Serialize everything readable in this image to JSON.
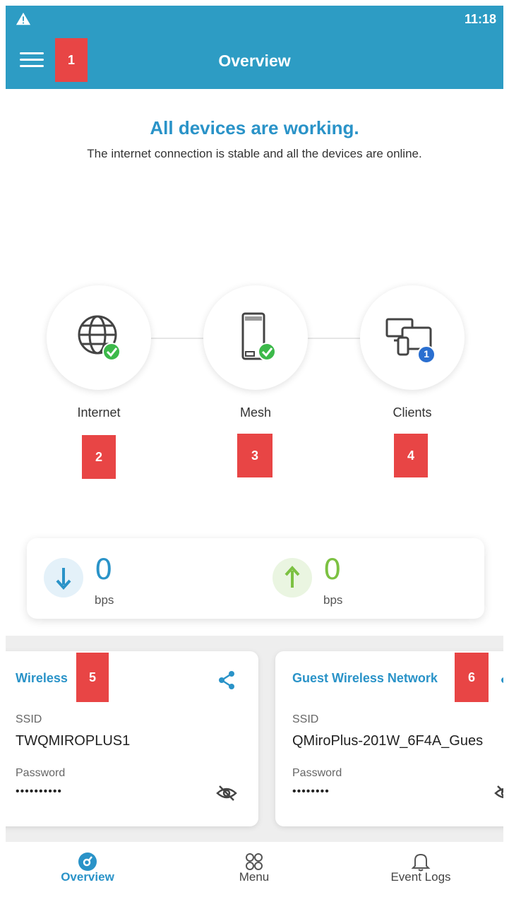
{
  "status_bar": {
    "time": "11:18"
  },
  "app_bar": {
    "title": "Overview"
  },
  "annotations": [
    "1",
    "2",
    "3",
    "4",
    "5",
    "6"
  ],
  "status": {
    "headline": "All devices are working.",
    "message": "The internet connection is stable and all the devices are online."
  },
  "topology": [
    {
      "label": "Internet",
      "icon": "globe-icon",
      "badge": "check"
    },
    {
      "label": "Mesh",
      "icon": "router-icon",
      "badge": "check"
    },
    {
      "label": "Clients",
      "icon": "devices-icon",
      "badge": "1"
    }
  ],
  "throughput": {
    "download": {
      "value": "0",
      "unit": "bps",
      "color": "#2a93c8"
    },
    "upload": {
      "value": "0",
      "unit": "bps",
      "color": "#7cc142"
    }
  },
  "networks": [
    {
      "title": "Wireless",
      "ssid_label": "SSID",
      "ssid": "TWQMIROPLUS1",
      "password_label": "Password",
      "password": "••••••••••"
    },
    {
      "title": "Guest Wireless Network",
      "ssid_label": "SSID",
      "ssid": "QMiroPlus-201W_6F4A_Gues",
      "password_label": "Password",
      "password": "••••••••"
    }
  ],
  "bottom_nav": [
    {
      "label": "Overview",
      "icon": "overview-icon",
      "active": true
    },
    {
      "label": "Menu",
      "icon": "grid-icon",
      "active": false
    },
    {
      "label": "Event Logs",
      "icon": "bell-icon",
      "active": false
    }
  ],
  "colors": {
    "primary": "#2d9cc4",
    "accent_text": "#2a93c8",
    "success": "#3cb94a",
    "tag": "#e84545"
  }
}
